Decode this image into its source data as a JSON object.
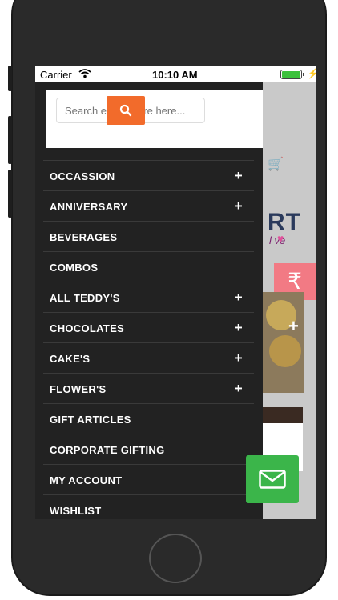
{
  "status_bar": {
    "carrier": "Carrier",
    "time": "10:10 AM",
    "battery_color": "#3cc13c"
  },
  "search": {
    "placeholder": "Search entire store here..."
  },
  "menu": {
    "items": [
      {
        "label": "OCCASSION",
        "expandable": true
      },
      {
        "label": "ANNIVERSARY",
        "expandable": true
      },
      {
        "label": "BEVERAGES",
        "expandable": false
      },
      {
        "label": "COMBOS",
        "expandable": false
      },
      {
        "label": "ALL TEDDY'S",
        "expandable": true
      },
      {
        "label": "CHOCOLATES",
        "expandable": true
      },
      {
        "label": "CAKE'S",
        "expandable": true
      },
      {
        "label": "FLOWER'S",
        "expandable": true
      },
      {
        "label": "GIFT ARTICLES",
        "expandable": false
      },
      {
        "label": "CORPORATE GIFTING",
        "expandable": false
      },
      {
        "label": "MY ACCOUNT",
        "expandable": false
      },
      {
        "label": "WISHLIST",
        "expandable": false
      }
    ]
  },
  "background_app": {
    "logo_text": "RT",
    "logo_sub": "l ve",
    "currency_symbol": "₹"
  },
  "colors": {
    "accent": "#f26b2b",
    "drawer_bg": "#222222",
    "mail_button": "#3bb54a",
    "rupee_button": "#f27a84"
  },
  "icons": {
    "search": "search-icon",
    "expand": "plus-icon",
    "mail": "mail-icon",
    "cart": "cart-icon"
  }
}
